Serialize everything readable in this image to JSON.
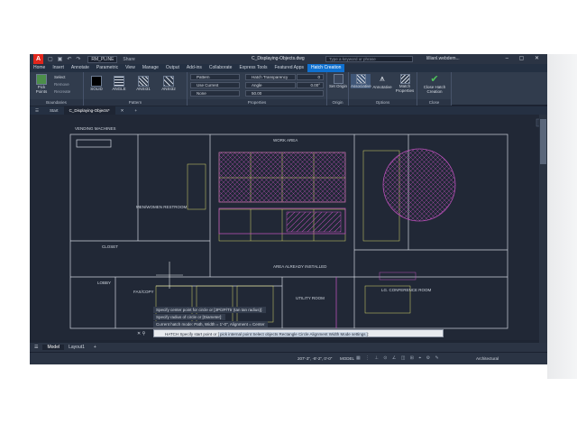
{
  "titlebar": {
    "logo": "A",
    "workspace": "RM_PLINE",
    "share": "Share",
    "doc_title": "C_Displaying-Objects.dwg",
    "search_placeholder": "Type a keyword or phrase",
    "user": "lillianl.webdem..."
  },
  "menu": [
    "Home",
    "Insert",
    "Annotate",
    "Parametric",
    "View",
    "Manage",
    "Output",
    "Add-ins",
    "Collaborate",
    "Express Tools",
    "Featured Apps",
    "Hatch Creation"
  ],
  "menu_active": "Hatch Creation",
  "ribbon": {
    "boundaries": {
      "title": "Boundaries",
      "pick_points": "Pick Points",
      "select": "Select",
      "remove": "Remove",
      "recreate": "Recreate"
    },
    "pattern": {
      "title": "Pattern",
      "swatches": [
        "SOLID",
        "ANGLE",
        "ANSI31",
        "ANSI32"
      ]
    },
    "properties": {
      "title": "Properties",
      "type": "Pattern",
      "color": "Use Current",
      "background": "None",
      "transparency_label": "Hatch Transparency",
      "transparency_value": "0",
      "angle_label": "Angle",
      "angle_value": "0.00°",
      "scale_value": "50.00"
    },
    "origin": {
      "title": "Origin",
      "set_origin": "Set Origin"
    },
    "options": {
      "title": "Options",
      "associative": "Associative",
      "annotative": "Annotative",
      "match": "Match Properties"
    },
    "close": {
      "title": "Close",
      "close_hatch": "Close Hatch Creation"
    }
  },
  "tabs": [
    "Start",
    "C_Displaying-Objects*"
  ],
  "drawing_labels": {
    "vending": "VENDING MACHINES",
    "menwomen": "MEN/WOMEN RESTROOM",
    "closet": "CLOSET",
    "lobby": "LOBBY",
    "faxcopy": "FAX/COPY",
    "utility": "UTILITY ROOM",
    "conference": "LG. CONFERENCE ROOM",
    "area_installed": "AREA ALREADY INSTALLED",
    "work_area": "WORK AREA"
  },
  "command_history": [
    "Specify center point for circle or [3P/2P/Ttr (tan tan radius)]:",
    "Specify radius of circle or [Diameter]:",
    "Current hatch mode: Path, Width = 1'-0\", Alignment = Center"
  ],
  "command_prompt": {
    "prefix": "HATCH Specify start point or [",
    "options": "pick internal point Select objects Rectangle Circle Alignment Width Mode settings",
    "suffix": "]:"
  },
  "layouts": [
    "Model",
    "Layout1"
  ],
  "status": {
    "coords": "207'-3\", -8'-2\", 0'-0\"",
    "model": "MODEL",
    "scale": "Architectural"
  },
  "colors": {
    "hatch_magenta": "#b74fb6",
    "linework_yellow": "#d9d96a",
    "linework_white": "#cfd5de",
    "accent_blue": "#0f70cf"
  }
}
